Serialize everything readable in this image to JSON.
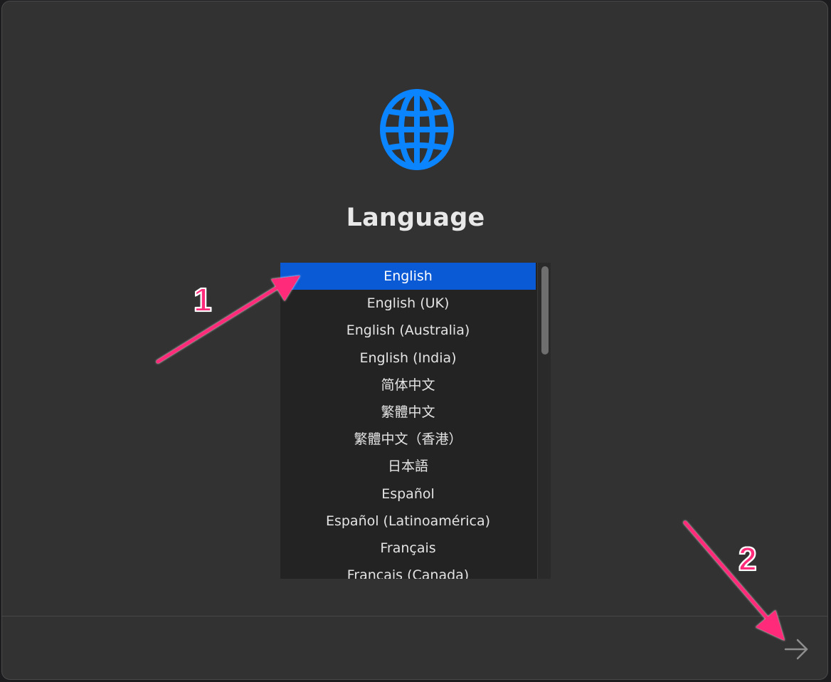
{
  "setup": {
    "title": "Language",
    "icon": "globe-icon",
    "accent_color": "#0a84ff",
    "selection_color": "#0a5ad6"
  },
  "languages": [
    {
      "label": "English",
      "selected": true
    },
    {
      "label": "English (UK)",
      "selected": false
    },
    {
      "label": "English (Australia)",
      "selected": false
    },
    {
      "label": "English (India)",
      "selected": false
    },
    {
      "label": "简体中文",
      "selected": false
    },
    {
      "label": "繁體中文",
      "selected": false
    },
    {
      "label": "繁體中文（香港）",
      "selected": false
    },
    {
      "label": "日本語",
      "selected": false
    },
    {
      "label": "Español",
      "selected": false
    },
    {
      "label": "Español (Latinoamérica)",
      "selected": false
    },
    {
      "label": "Français",
      "selected": false
    },
    {
      "label": "Français (Canada)",
      "selected": false
    }
  ],
  "navigation": {
    "next_icon": "arrow-right-icon"
  },
  "annotations": {
    "marker_1": "1",
    "marker_2": "2",
    "color": "#ff2a7a"
  }
}
